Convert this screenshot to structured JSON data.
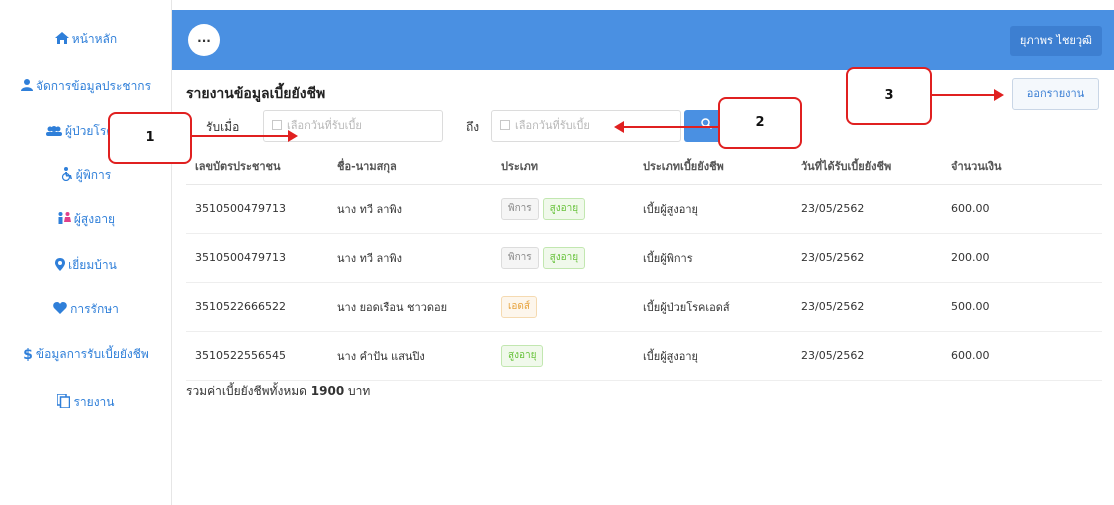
{
  "sidebar": {
    "items": [
      {
        "label": "หน้าหลัก",
        "icon": "home-icon"
      },
      {
        "label": "จัดการข้อมูลประชากร",
        "icon": "person-icon"
      },
      {
        "label": "ผู้ป่วยโรค",
        "icon": "group-icon"
      },
      {
        "label": "ผู้พิการ",
        "icon": "wheelchair-icon"
      },
      {
        "label": "ผู้สูงอายุ",
        "icon": "elderly-icon"
      },
      {
        "label": "เยี่ยมบ้าน",
        "icon": "map-pin-icon"
      },
      {
        "label": "การรักษา",
        "icon": "heart-icon"
      },
      {
        "label": "ข้อมูลการรับเบี้ยยังชีพ",
        "icon": "dollar-icon"
      },
      {
        "label": "รายงาน",
        "icon": "copy-icon"
      }
    ]
  },
  "header": {
    "menu_label": "...",
    "user_name": "ยุภาพร ไชยวุฒิ"
  },
  "page": {
    "title": "รายงานข้อมูลเบี้ยยังชีพ",
    "export_label": "ออกรายงาน"
  },
  "filter": {
    "from_label": "รับเมื่อ",
    "to_label": "ถึง",
    "from_placeholder": "เลือกวันที่รับเบี้ย",
    "to_placeholder": "เลือกวันที่รับเบี้ย"
  },
  "table": {
    "columns": [
      "เลขบัตรประชาชน",
      "ชื่อ-นามสกุล",
      "ประเภท",
      "ประเภทเบี้ยยังชีพ",
      "วันที่ได้รับเบี้ยยังชีพ",
      "จำนวนเงิน"
    ],
    "rows": [
      {
        "id": "3510500479713",
        "name": "นาง ทวี ลาพิง",
        "tags": [
          {
            "text": "พิการ",
            "style": "gray"
          },
          {
            "text": "สูงอายุ",
            "style": "green"
          }
        ],
        "allowance": "เบี้ยผู้สูงอายุ",
        "date": "23/05/2562",
        "amount": "600.00"
      },
      {
        "id": "3510500479713",
        "name": "นาง ทวี ลาพิง",
        "tags": [
          {
            "text": "พิการ",
            "style": "gray"
          },
          {
            "text": "สูงอายุ",
            "style": "green"
          }
        ],
        "allowance": "เบี้ยผู้พิการ",
        "date": "23/05/2562",
        "amount": "200.00"
      },
      {
        "id": "3510522666522",
        "name": "นาง ยอดเรือน ชาวดอย",
        "tags": [
          {
            "text": "เอดส์",
            "style": "orange"
          }
        ],
        "allowance": "เบี้ยผู้ป่วยโรคเอดส์",
        "date": "23/05/2562",
        "amount": "500.00"
      },
      {
        "id": "3510522556545",
        "name": "นาง คำปัน แสนปิง",
        "tags": [
          {
            "text": "สูงอายุ",
            "style": "green"
          }
        ],
        "allowance": "เบี้ยผู้สูงอายุ",
        "date": "23/05/2562",
        "amount": "600.00"
      }
    ]
  },
  "summary": {
    "prefix": "รวมค่าเบี้ยยังชีพทั้งหมด",
    "total": "1900",
    "unit": "บาท"
  },
  "callouts": [
    "1",
    "2",
    "3"
  ],
  "colors": {
    "accent": "#4a90e2",
    "annotation": "#e02020"
  }
}
